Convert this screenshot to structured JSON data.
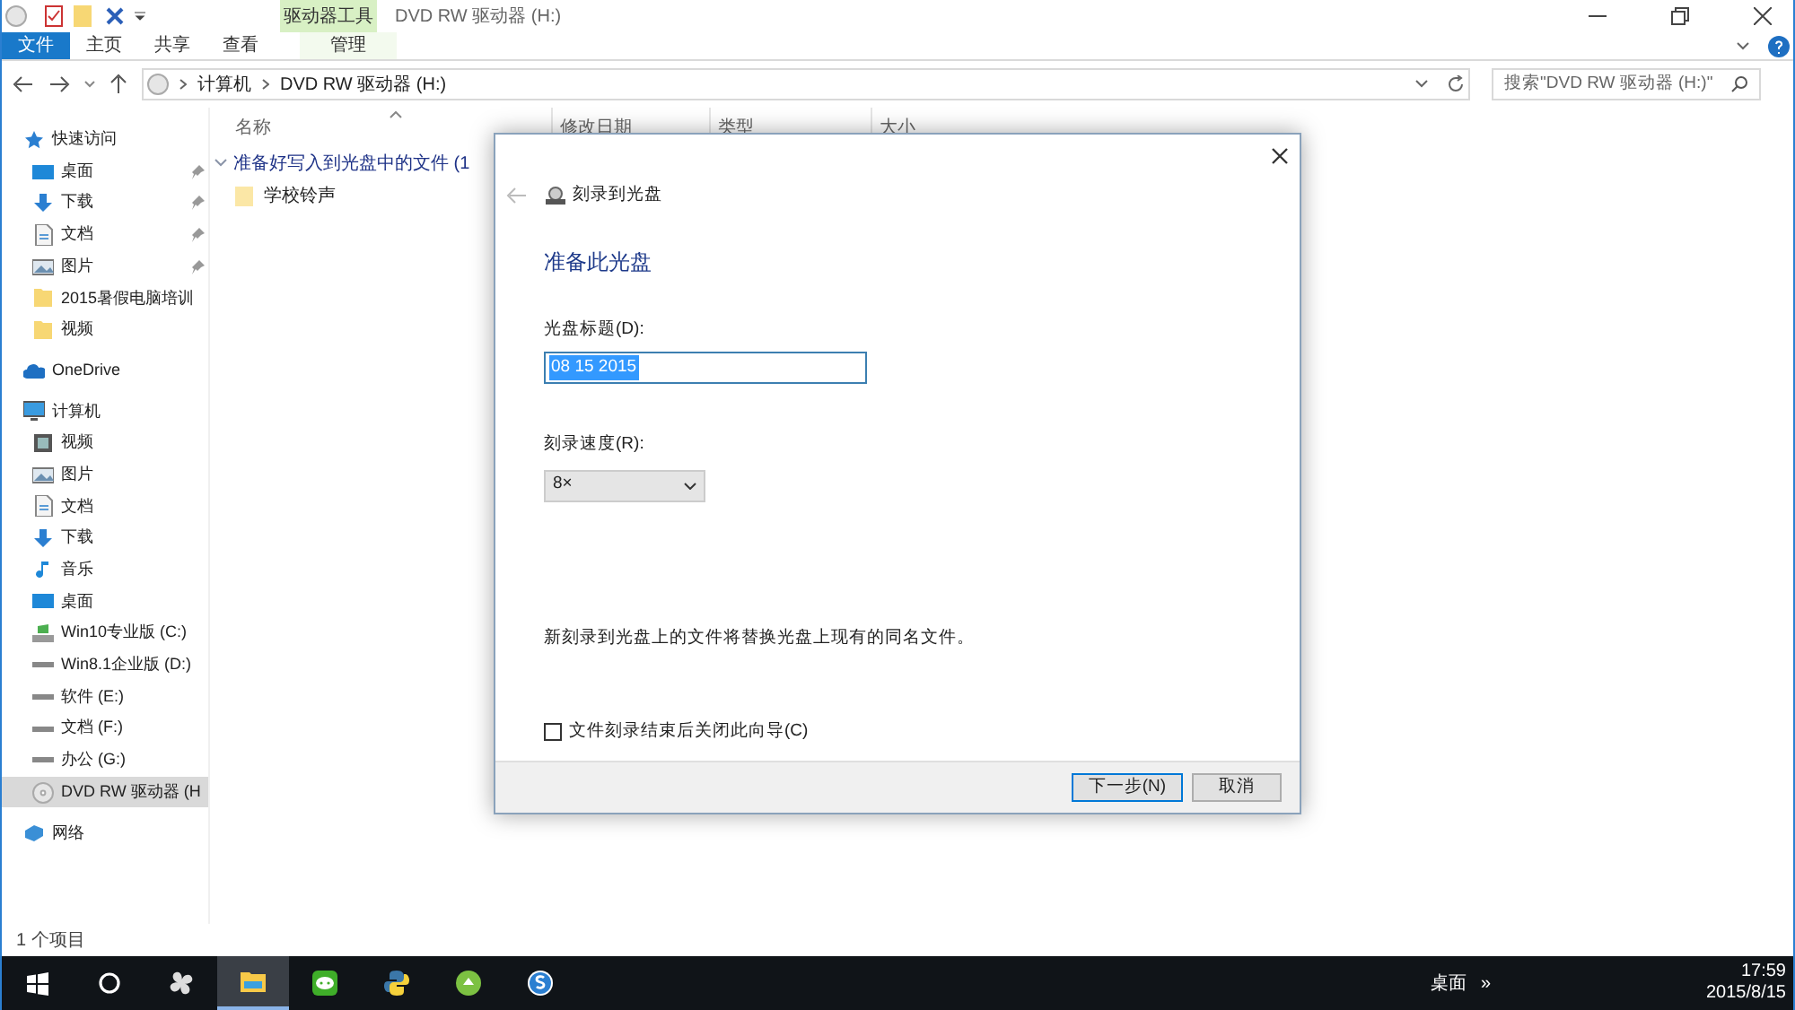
{
  "window": {
    "title": "DVD RW 驱动器 (H:)",
    "contextual_group": "驱动器工具"
  },
  "ribbon_tabs": [
    {
      "label": "文件",
      "kind": "file",
      "selected": false
    },
    {
      "label": "主页",
      "kind": "tab",
      "selected": false
    },
    {
      "label": "共享",
      "kind": "tab",
      "selected": false
    },
    {
      "label": "查看",
      "kind": "tab",
      "selected": false
    },
    {
      "label": "管理",
      "kind": "contextual",
      "selected": false
    }
  ],
  "address": {
    "path": [
      "计算机",
      "DVD RW 驱动器 (H:)"
    ],
    "search_placeholder": "搜索\"DVD RW 驱动器 (H:)\""
  },
  "nav": [
    {
      "label": "快速访问",
      "kind": "star",
      "children": [
        {
          "label": "桌面",
          "kind": "desktop",
          "pinned": true
        },
        {
          "label": "下载",
          "kind": "download",
          "pinned": true
        },
        {
          "label": "文档",
          "kind": "document",
          "pinned": true
        },
        {
          "label": "图片",
          "kind": "picture",
          "pinned": true
        },
        {
          "label": "2015暑假电脑培训",
          "kind": "folder",
          "pinned": false
        },
        {
          "label": "视频",
          "kind": "folder",
          "pinned": false
        }
      ]
    },
    {
      "label": "OneDrive",
      "kind": "cloud"
    },
    {
      "label": "计算机",
      "kind": "computer",
      "children": [
        {
          "label": "视频",
          "kind": "video",
          "pinned": false
        },
        {
          "label": "图片",
          "kind": "picture",
          "pinned": false
        },
        {
          "label": "文档",
          "kind": "document",
          "pinned": false
        },
        {
          "label": "下载",
          "kind": "download",
          "pinned": false
        },
        {
          "label": "音乐",
          "kind": "music",
          "pinned": false
        },
        {
          "label": "桌面",
          "kind": "desktop",
          "pinned": false
        },
        {
          "label": "Win10专业版 (C:)",
          "kind": "windrive",
          "pinned": false
        },
        {
          "label": "Win8.1企业版 (D:)",
          "kind": "drive",
          "pinned": false
        },
        {
          "label": "软件 (E:)",
          "kind": "drive",
          "pinned": false
        },
        {
          "label": "文档 (F:)",
          "kind": "drive",
          "pinned": false
        },
        {
          "label": "办公 (G:)",
          "kind": "drive",
          "pinned": false
        },
        {
          "label": "DVD RW 驱动器 (H",
          "kind": "dvd",
          "pinned": false,
          "selected": true
        }
      ]
    },
    {
      "label": "网络",
      "kind": "network"
    }
  ],
  "columns": [
    "名称",
    "修改日期",
    "类型",
    "大小"
  ],
  "group": {
    "label": "准备好写入到光盘中的文件 (1",
    "expanded": true
  },
  "files": [
    "学校铃声"
  ],
  "status_bar": "1 个项目",
  "dialog": {
    "step_title": "刻录到光盘",
    "heading": "准备此光盘",
    "title_label": "光盘标题(D):",
    "title_value": "08 15 2015",
    "speed_label": "刻录速度(R):",
    "speed_value": "8×",
    "note": "新刻录到光盘上的文件将替换光盘上现有的同名文件。",
    "close_option": {
      "label": "文件刻录结束后关闭此向导(C)",
      "checked": false
    },
    "buttons": [
      {
        "label": "下一步(N)",
        "default": true
      },
      {
        "label": "取消",
        "default": false
      }
    ]
  },
  "taskbar": {
    "apps": [
      {
        "kind": "start",
        "active": false
      },
      {
        "kind": "cortana",
        "active": false
      },
      {
        "kind": "pinwheel",
        "active": false
      },
      {
        "kind": "explorer",
        "active": true
      },
      {
        "kind": "chat",
        "active": false
      },
      {
        "kind": "python",
        "active": false
      },
      {
        "kind": "greenapp",
        "active": false
      },
      {
        "kind": "browser",
        "active": false
      }
    ],
    "desktop_label": "桌面",
    "overflow": "»",
    "time": "17:59",
    "date": "2015/8/15"
  }
}
